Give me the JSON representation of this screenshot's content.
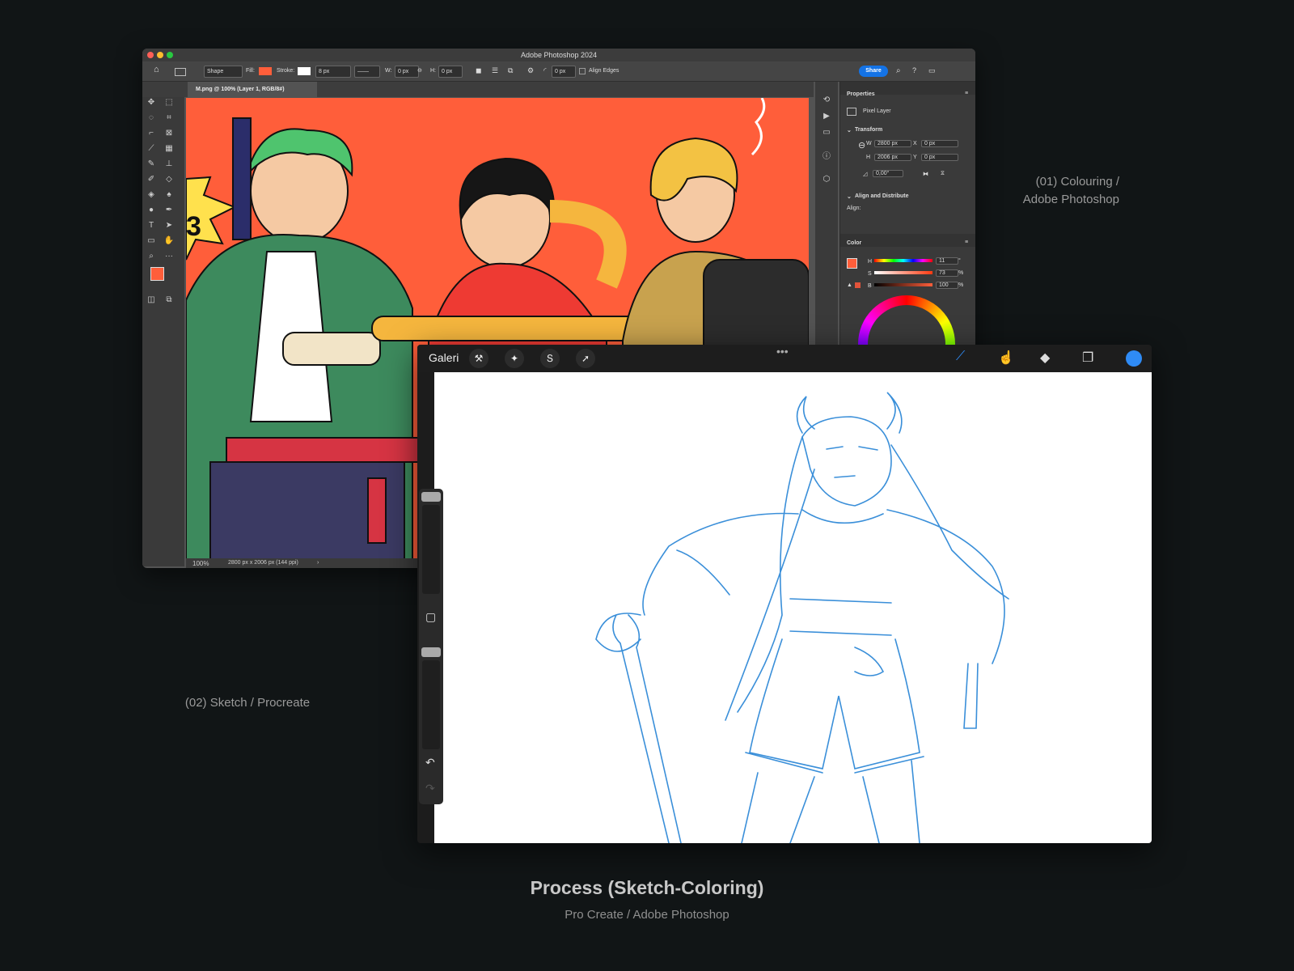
{
  "photoshop": {
    "window_title": "Adobe Photoshop 2024",
    "options": {
      "shape_mode": "Shape",
      "fill_label": "Fill:",
      "stroke_label": "Stroke:",
      "stroke_width": "8 px",
      "w_label": "W:",
      "w_value": "0 px",
      "h_label": "H:",
      "h_value": "0 px",
      "radius_value": "0 px",
      "align_edges": "Align Edges",
      "share": "Share"
    },
    "doc_tab": "M.png @ 100% (Layer 1, RGB/8#)",
    "status": {
      "zoom": "100%",
      "info": "2800 px x 2006 px (144 ppi)"
    },
    "properties": {
      "title": "Properties",
      "layer_type": "Pixel Layer",
      "transform": "Transform",
      "w_label": "W",
      "w": "2800 px",
      "x_label": "X",
      "x": "0 px",
      "h_label": "H",
      "h": "2006 px",
      "y_label": "Y",
      "y": "0 px",
      "angle": "0,00°",
      "align_distribute": "Align and Distribute",
      "align": "Align:"
    },
    "color_panel": {
      "title": "Color",
      "h_label": "H",
      "h": "11",
      "h_unit": "°",
      "s_label": "S",
      "s": "73",
      "s_unit": "%",
      "b_label": "B",
      "b": "100",
      "b_unit": "%"
    },
    "colors": {
      "foreground": "#ff5e3a",
      "canvas_bg": "#ff5e3a"
    }
  },
  "procreate": {
    "gallery": "Galeri",
    "top_left_icons": [
      "wrench-icon",
      "magic-wand-icon",
      "selection-icon",
      "transform-arrow-icon"
    ],
    "top_right_icons": [
      "brush-icon",
      "smudge-icon",
      "eraser-icon",
      "layers-icon"
    ],
    "active_color": "#2f8bf5"
  },
  "captions": {
    "colouring_1": "(01) Colouring /",
    "colouring_2": "Adobe Photoshop",
    "sketch": "(02) Sketch / Procreate",
    "title": "Process (Sketch-Coloring)",
    "subtitle": "Pro Create / Adobe Photoshop"
  }
}
